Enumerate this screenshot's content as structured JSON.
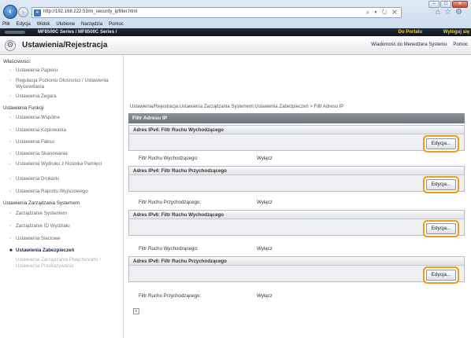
{
  "browser": {
    "url": "http://192.168.222.53/m_security_ipfilter.html",
    "address_controls": "⌕ ▾ ↻ ✕",
    "menu": [
      "Plik",
      "Edycja",
      "Widok",
      "Ulubione",
      "Narzędzia",
      "Pomoc"
    ]
  },
  "printer_bar": {
    "model": "MF8500C Series / MF8500C Series /",
    "portal": "Do Portalu",
    "logout": "Wyloguj się"
  },
  "header": {
    "title": "Ustawienia/Rejestracja",
    "links": [
      "Wiadomość do Menedżera Systemu",
      "Pomoc"
    ]
  },
  "sidebar": {
    "groups": [
      {
        "label": "Właściwości:",
        "items": [
          {
            "label": "Ustawienia Papieru"
          },
          {
            "label": "Regulacja Poziomu Głośności / Ustawienia Wyświetlania"
          },
          {
            "label": "Ustawienia Zegara"
          }
        ]
      },
      {
        "label": "Ustawienia Funkcji",
        "items": [
          {
            "label": "Ustawienia Wspólne"
          },
          {
            "label": "Ustawienia Kopiowania"
          },
          {
            "label": "Ustawienia Faksu"
          },
          {
            "label": "Ustawienia Skanowania"
          },
          {
            "label": "Ustawienia Wydruku z Nośnika Pamięci"
          },
          {
            "label": "Ustawienia Drukarki"
          },
          {
            "label": "Ustawienia Raportu Wyjściowego"
          }
        ]
      },
      {
        "label": "Ustawienia Zarządzania Systemem",
        "items": [
          {
            "label": "Zarządzanie Systemem"
          },
          {
            "label": "Zarządzanie ID Wydziału"
          },
          {
            "label": "Ustawienia Sieciowe"
          },
          {
            "label": "Ustawienia Zabezpieczeń"
          },
          {
            "label": "Ustawienia Zarządzania Połączeniami / Ustawienia Przekazywania"
          }
        ]
      }
    ]
  },
  "main": {
    "breadcrumb": "Ustawienia/Rejestracja:Ustawienia Zarządzania Systemem:Ustawienia Zabezpieczeń > Filtr Adresu IP",
    "section_title": "Filtr Adresu IP",
    "edit_label": "Edycja...",
    "panels": [
      {
        "title": "Adres IPv4: Filtr Ruchu Wychodzącego",
        "stat_label": "Filtr Ruchu Wychodzącego:",
        "stat_value": "Wyłącz"
      },
      {
        "title": "Adres IPv4: Filtr Ruchu Przychodzącego",
        "stat_label": "Filtr Ruchu Przychodzącego:",
        "stat_value": "Wyłącz"
      },
      {
        "title": "Adres IPv6: Filtr Ruchu Wychodzącego",
        "stat_label": "Filtr Ruchu Wychodzącego:",
        "stat_value": "Wyłącz"
      },
      {
        "title": "Adres IPv6: Filtr Ruchu Przychodzącego",
        "stat_label": "Filtr Ruchu Przychodzącego:",
        "stat_value": "Wyłącz"
      }
    ]
  },
  "colors": {
    "highlight_ring": "#f39b1b",
    "portal_link": "#ffd400",
    "section_bar": "#6d737b"
  }
}
